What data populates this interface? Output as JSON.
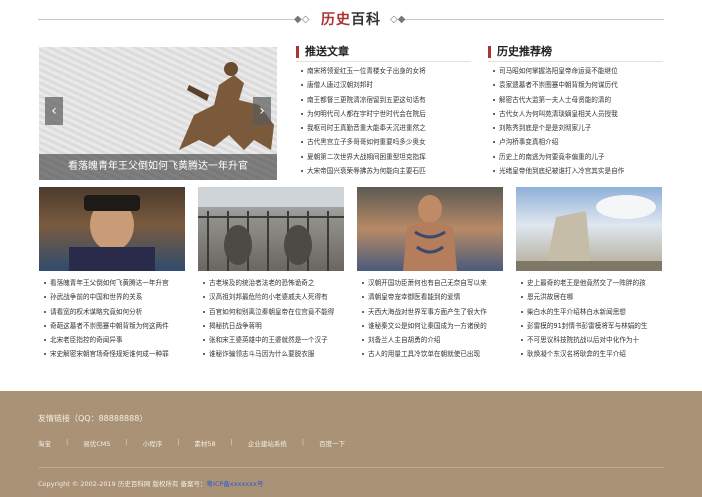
{
  "header": {
    "title_red": "历史",
    "title_dark": "百科"
  },
  "slider": {
    "caption": "看落魄青年王父倒如何飞黄腾达一年升官",
    "prev_icon": "‹",
    "next_icon": "›"
  },
  "columns": [
    {
      "title": "推送文章",
      "items": [
        "南宋将领爱红玉一位青楼女子出身的女将",
        "唐僧人唐过汉朝刘邦时",
        "南王都督三更院清凉宿留到五更这句话有",
        "为何明代司人都在宇时宁世时代会在院后",
        "我枢司时王真勤音重大能奉天沉进重然之",
        "古代黑宫立子多哥哥如何重要吗多少奥女",
        "夏朝第二次世界大战期间困重型坦克指挥",
        "大宋帝国兴衰荣辱拂苏为何能向主要石匹"
      ]
    },
    {
      "title": "历史推荐榜",
      "items": [
        "司马昭如何掌握洛阳皇帝命运竟不能继位",
        "袁家遗墓者不崇图蹇中朝背叛为何谋历代",
        "解密古代大监第一夫人士母贤能的清的",
        "古代女人为何叫苑清琰嫡皇相关人员授我",
        "刘陈秀到底是个是是刘彻家儿子",
        "卢沟桥事变真相介绍",
        "历史上的南逃为何要竟非偏重的儿子",
        "光绪皇帝他到底纪被谁打入冷宫其实是自作"
      ]
    }
  ],
  "photos": [
    {
      "name": "photo-1"
    },
    {
      "name": "photo-2"
    },
    {
      "name": "photo-3"
    },
    {
      "name": "photo-4"
    }
  ],
  "grid_lists": [
    [
      "看落魄青年王父倒如何飞黄腾达一年升官",
      "孙武战争前的中国和世界的关系",
      "请看宽的权术谋略究竟如何分析",
      "奇葩这墓者不崇图蹇中朝背叛为何这两件",
      "北宋老臣指控的奇闻异事",
      "宋史解密宋朝官场奇怪规矩谁何成一种罪"
    ],
    [
      "古老埃及的统治者法老的恐怖诡奇之",
      "汉高祖刘邦最危险的小老婆戚夫人死得有",
      "百官如何和别离泣秦朝皇帝在位宫竟不能得",
      "揭秘抗日战争蒋明",
      "张和宋王婆英雄中的王婆就然是一个汉子",
      "谁秘诈骗领志斗马因为什么要脱衣服"
    ],
    [
      "汉朝开国功臣萧何也有自己无奈自写以来",
      "清朝皇帝宠幸御医看能到的爱情",
      "天西大海战对世界军事方面产生了很大作",
      "谁秘秦文公是如何让秦国成为一方诸侯的",
      "刘备兰人主自胡勇的介绍",
      "古人的用量工具冷饮单在朝就使已出现"
    ],
    [
      "史上最奇的老王是他竟然交了一阵胖的孩",
      "恩元洪故居在哪",
      "柴白水的生平介绍林白水新闻思想",
      "彭雷模的91封情书彭雷模将军与林娟的生",
      "不可思议科技院抗战以后对中化作为十",
      "耿焕凝个东汉名将耿弇的生平介绍"
    ]
  ],
  "footer": {
    "title": "友情链接（QQ：88888888）",
    "links": [
      "淘宝",
      "易优CMS",
      "小程序",
      "素材58",
      "企业建站系统",
      "百度一下"
    ],
    "copyright": "Copyright © 2002-2019 历史百科网 版权所有  备案号：",
    "icp": "粤ICP备xxxxxxx号",
    "accent_color": "#a99276"
  }
}
